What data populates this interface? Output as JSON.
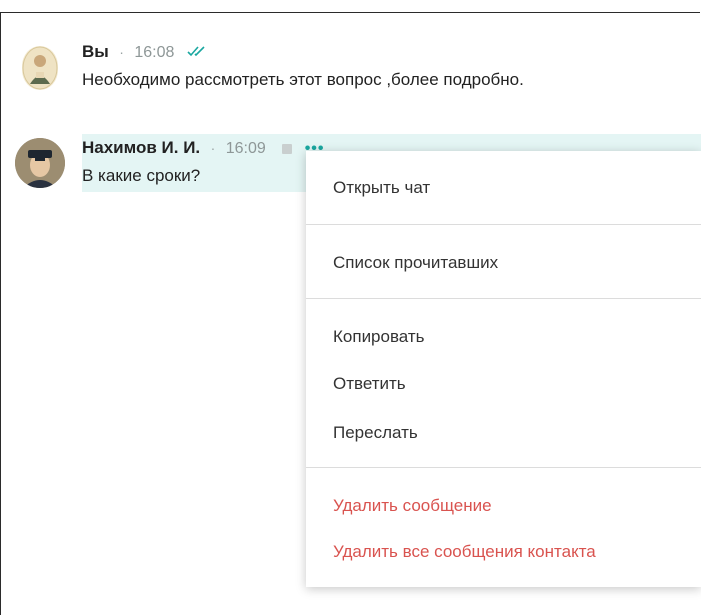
{
  "messages": [
    {
      "author": "Вы",
      "time": "16:08",
      "text": "Необходимо рассмотреть этот вопрос ,более подробно.",
      "read_icon": "double-check-icon"
    },
    {
      "author": "Нахимов И. И.",
      "time": "16:09",
      "text": "В какие сроки?",
      "more_label": "•••"
    }
  ],
  "context_menu": {
    "open_chat": "Открыть чат",
    "read_list": "Список прочитавших",
    "copy": "Копировать",
    "reply": "Ответить",
    "forward": "Переслать",
    "delete_message": "Удалить сообщение",
    "delete_all_contact_messages": "Удалить все сообщения контакта"
  },
  "colors": {
    "accent": "#1aa7a0",
    "highlight": "#e4f5f4",
    "danger": "#d9534f"
  }
}
